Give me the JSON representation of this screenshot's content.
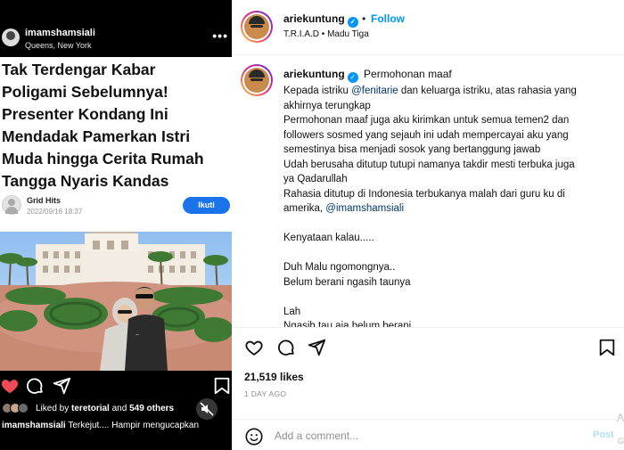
{
  "left": {
    "username": "imamshamsiali",
    "location": "Queens, New York",
    "more": "•••",
    "headline_lines": [
      "Tak Terdengar Kabar",
      "Poligami Sebelumnya!",
      "Presenter Kondang Ini",
      "Mendadak Pamerkan Istri",
      "Muda hingga Cerita Rumah",
      "Tangga Nyaris Kandas"
    ],
    "source_name": "Grid Hits",
    "source_date": "2022/09/16 18:37",
    "follow_label": "Ikuti",
    "liked_by_prefix": "Liked by ",
    "liked_by_user": "teretorial",
    "liked_by_and": " and ",
    "liked_by_others": "549 others",
    "caption_user": "imamshamsiali",
    "caption_text": " Terkejut.... Hampir mengucapkan"
  },
  "post": {
    "username": "ariekuntung",
    "dot": "•",
    "follow_label": "Follow",
    "subtitle": "T.R.I.A.D • Madu Tiga",
    "caption_title": "Permohonan maaf",
    "caption_lines": [
      [
        "Kepada istriku ",
        "@fenitarie",
        " dan keluarga istriku, atas rahasia yang"
      ],
      [
        "akhirnya terungkap"
      ],
      [
        "Permohonan maaf juga aku kirimkan untuk semua temen2 dan"
      ],
      [
        "followers sosmed yang sejauh ini udah mempercayai aku yang"
      ],
      [
        "semestinya bisa menjadi sosok yang bertanggung jawab"
      ],
      [
        "Udah berusaha ditutup tutupi namanya takdir mesti terbuka juga"
      ],
      [
        "ya Qadarullah"
      ],
      [
        "Rahasia ditutup di Indonesia terbukanya malah dari guru ku di"
      ],
      [
        "amerika, ",
        "@imamshamsiali",
        ""
      ],
      [
        ""
      ],
      [
        "Kenyataan kalau....."
      ],
      [
        ""
      ],
      [
        "Duh Malu ngomongnya.."
      ],
      [
        "Belum berani ngasih taunya"
      ],
      [
        ""
      ],
      [
        "Lah"
      ],
      [
        "Ngasih tau aja belum berani"
      ]
    ],
    "likes": "21,519 likes",
    "time": "1 DAY AGO",
    "comment_placeholder": "Add a comment...",
    "post_label": "Post",
    "ghost_a": "A",
    "ghost_g": "G"
  },
  "colors": {
    "accent": "#0095f6",
    "like_red": "#ed4956",
    "follow_btn": "#1a73e8"
  },
  "icons": {
    "left_actions": [
      "heart-filled-icon",
      "comment-icon",
      "share-icon",
      "bookmark-icon"
    ],
    "right_actions": [
      "heart-icon",
      "comment-icon",
      "share-icon",
      "bookmark-icon"
    ],
    "mute": "speaker-muted-icon",
    "emoji": "smiley-icon",
    "verified": "verified-badge-icon"
  }
}
